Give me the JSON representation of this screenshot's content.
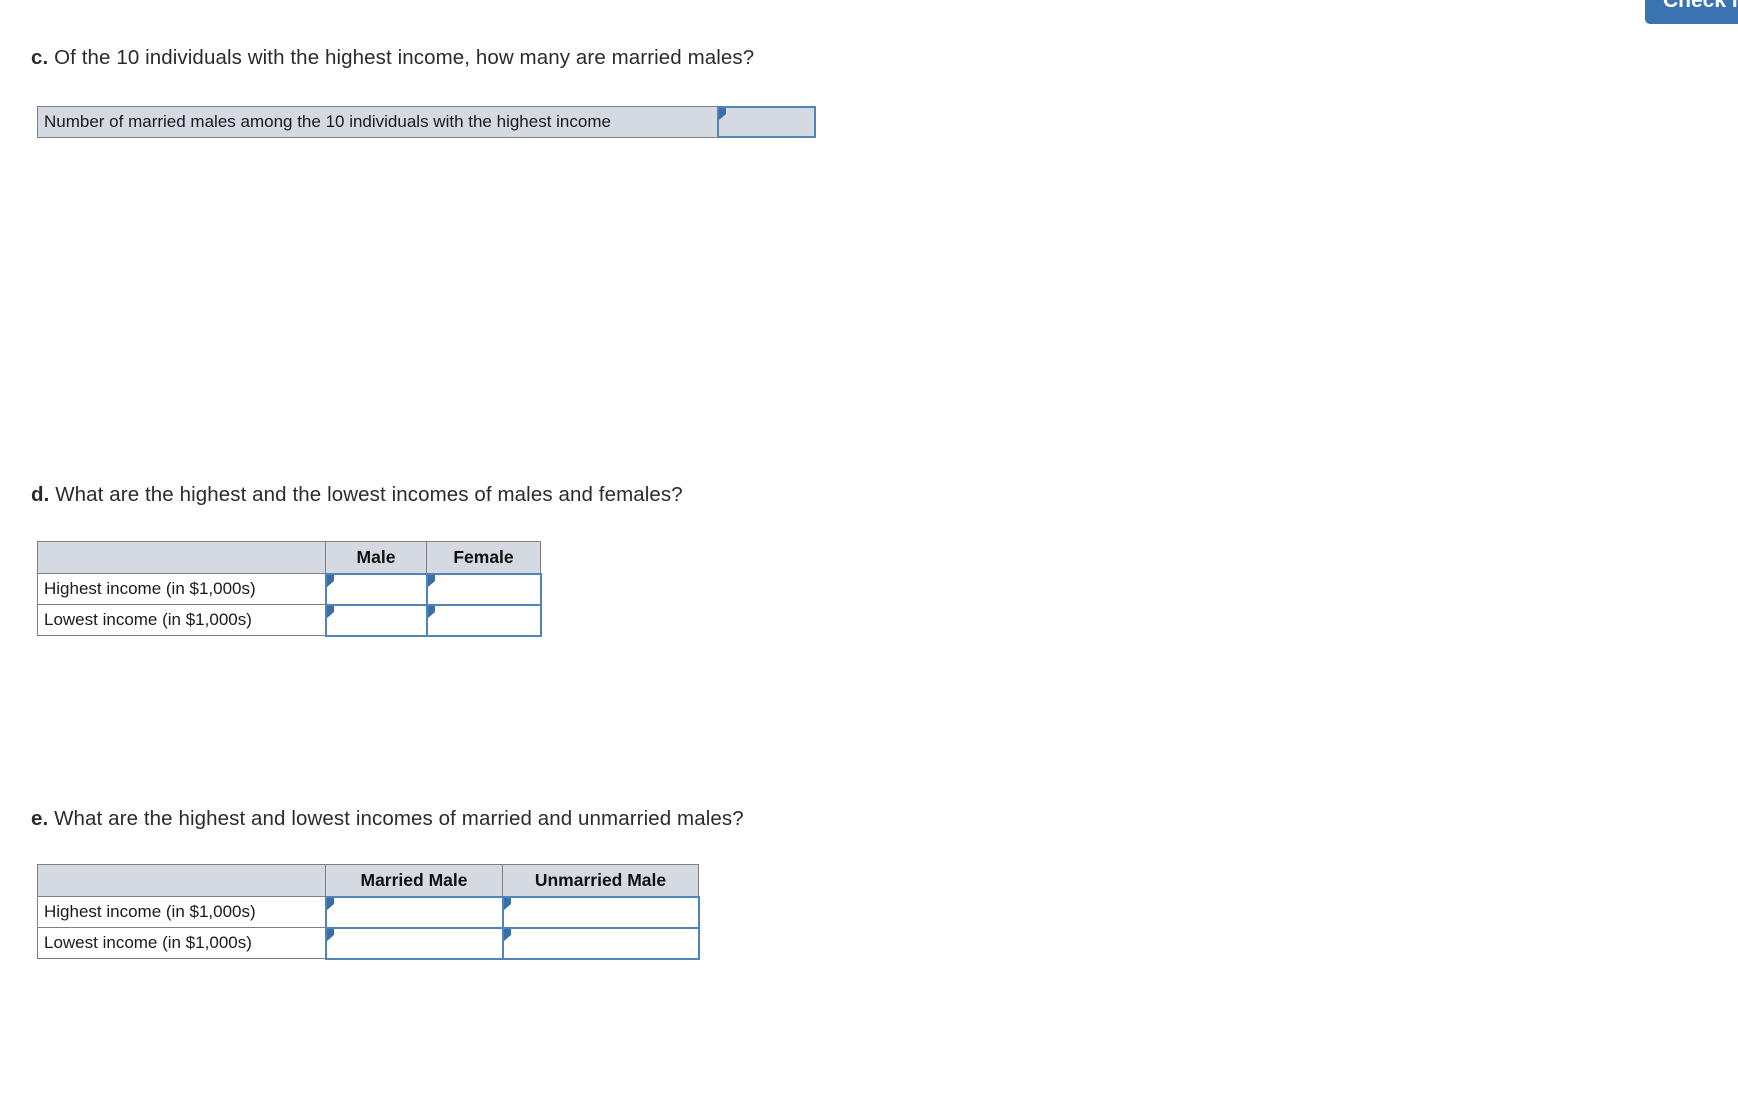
{
  "toolbar": {
    "check_button_label": "Check my"
  },
  "colors": {
    "accent_blue": "#3b72b0",
    "input_border_blue": "#5183bc",
    "marker_blue": "#3a6ea8",
    "header_fill": "#d5d9e2",
    "grid_line": "#7f7f7f"
  },
  "sections": {
    "c": {
      "letter": "c.",
      "question": "Of the 10 individuals with the highest income, how many are married males?",
      "row_label": "Number of married males among the 10 individuals with the highest income",
      "answer_value": ""
    },
    "d": {
      "letter": "d.",
      "question": "What are the highest and the lowest incomes of males and females?",
      "table": {
        "columns": [
          "",
          "Male",
          "Female"
        ],
        "rows": [
          {
            "label": "Highest income (in $1,000s)",
            "values": [
              "",
              ""
            ]
          },
          {
            "label": "Lowest income (in $1,000s)",
            "values": [
              "",
              ""
            ]
          }
        ]
      }
    },
    "e": {
      "letter": "e.",
      "question": "What are the highest and lowest incomes of married and unmarried males?",
      "table": {
        "columns": [
          "",
          "Married Male",
          "Unmarried Male"
        ],
        "rows": [
          {
            "label": "Highest income (in $1,000s)",
            "values": [
              "",
              ""
            ]
          },
          {
            "label": "Lowest income (in $1,000s)",
            "values": [
              "",
              ""
            ]
          }
        ]
      }
    }
  }
}
